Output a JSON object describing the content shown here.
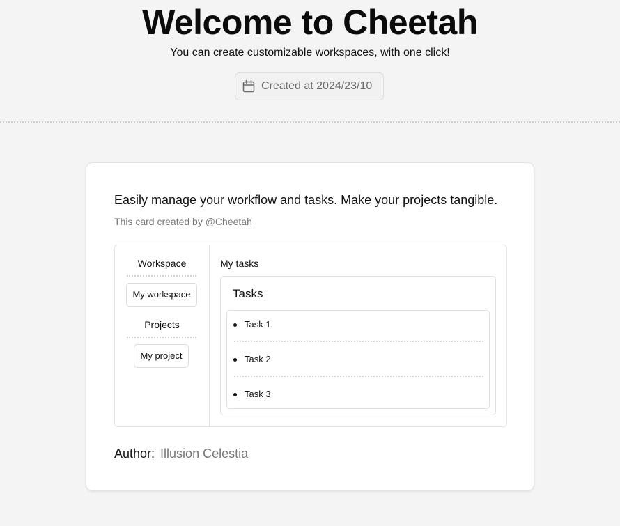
{
  "header": {
    "title": "Welcome to Cheetah",
    "subtitle": "You can create customizable workspaces, with one click!",
    "created_label": "Created at 2024/23/10",
    "created_icon": "calendar-icon"
  },
  "card": {
    "heading": "Easily manage your workflow and tasks. Make your projects tangible.",
    "caption": "This card created by @Cheetah",
    "sidebar": {
      "workspace_label": "Workspace",
      "workspace_button": "My workspace",
      "projects_label": "Projects",
      "project_button": "My project"
    },
    "main": {
      "label": "My tasks",
      "tasks_title": "Tasks",
      "tasks": [
        "Task 1",
        "Task 2",
        "Task 3"
      ]
    },
    "author": {
      "label": "Author:",
      "name": "Illusion Celestia"
    }
  },
  "colors": {
    "background": "#f4f4f4",
    "card": "#ffffff",
    "muted_text": "#777777",
    "border": "#e3e3e3"
  }
}
